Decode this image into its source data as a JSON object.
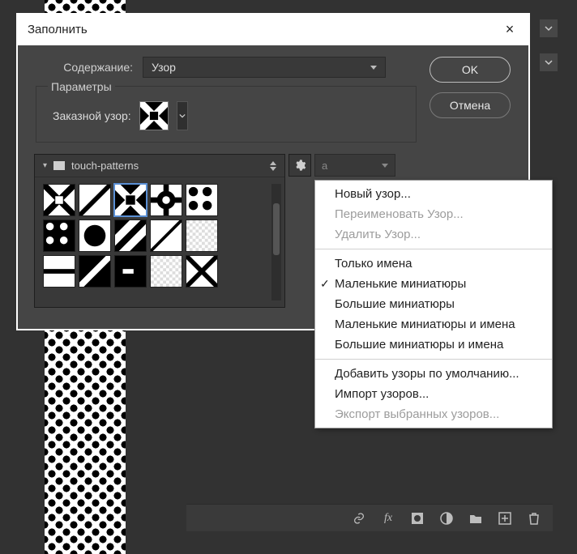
{
  "dialog": {
    "title": "Заполнить",
    "close": "×",
    "content_label": "Содержание:",
    "content_value": "Узор",
    "params_title": "Параметры",
    "custom_pattern_label": "Заказной узор:",
    "ok": "OK",
    "cancel": "Отмена"
  },
  "picker": {
    "folder": "touch-patterns"
  },
  "peek_letter": "а",
  "context_menu": {
    "items": [
      {
        "label": "Новый узор...",
        "enabled": true
      },
      {
        "label": "Переименовать Узор...",
        "enabled": false
      },
      {
        "label": "Удалить Узор...",
        "enabled": false
      }
    ],
    "view": [
      {
        "label": "Только имена",
        "checked": false
      },
      {
        "label": "Маленькие миниатюры",
        "checked": true
      },
      {
        "label": "Большие миниатюры",
        "checked": false
      },
      {
        "label": "Маленькие миниатюры и имена",
        "checked": false
      },
      {
        "label": "Большие миниатюры и имена",
        "checked": false
      }
    ],
    "io": [
      {
        "label": "Добавить узоры по умолчанию...",
        "enabled": true
      },
      {
        "label": "Импорт узоров...",
        "enabled": true
      },
      {
        "label": "Экспорт выбранных узоров...",
        "enabled": false
      }
    ]
  },
  "thumbs": {
    "selected_index": 2,
    "count": 15
  }
}
